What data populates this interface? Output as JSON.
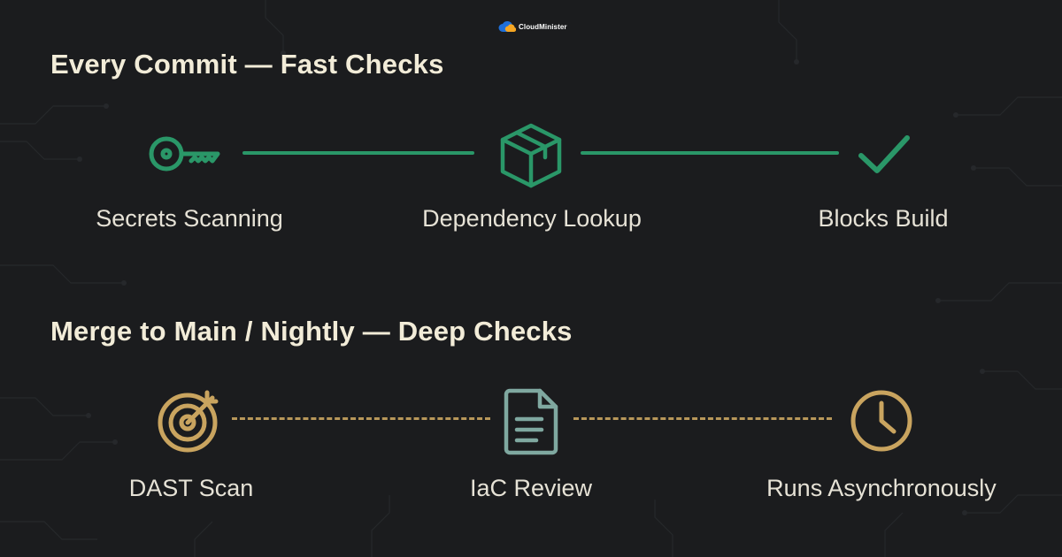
{
  "brand": {
    "name": "CloudMinister"
  },
  "sections": [
    {
      "title": "Every Commit — Fast Checks",
      "steps": [
        {
          "label": "Secrets Scanning",
          "icon": "key-icon"
        },
        {
          "label": "Dependency Lookup",
          "icon": "package-box-icon"
        },
        {
          "label": "Blocks Build",
          "icon": "checkmark-icon"
        }
      ],
      "connector_style": "solid",
      "accent_color": "#2a9768"
    },
    {
      "title": "Merge to Main / Nightly — Deep Checks",
      "steps": [
        {
          "label": "DAST Scan",
          "icon": "target-arrow-icon"
        },
        {
          "label": "IaC Review",
          "icon": "document-icon"
        },
        {
          "label": "Runs Asynchronously",
          "icon": "clock-icon"
        }
      ],
      "connector_style": "dashed",
      "accent_colors": [
        "#c9a45f",
        "#7fa8a0"
      ]
    }
  ],
  "colors": {
    "background": "#1b1c1e",
    "title_text": "#f2ecd8",
    "label_text": "#e6e2d6",
    "green": "#2a9768",
    "gold": "#c9a45f",
    "teal": "#7fa8a0"
  }
}
